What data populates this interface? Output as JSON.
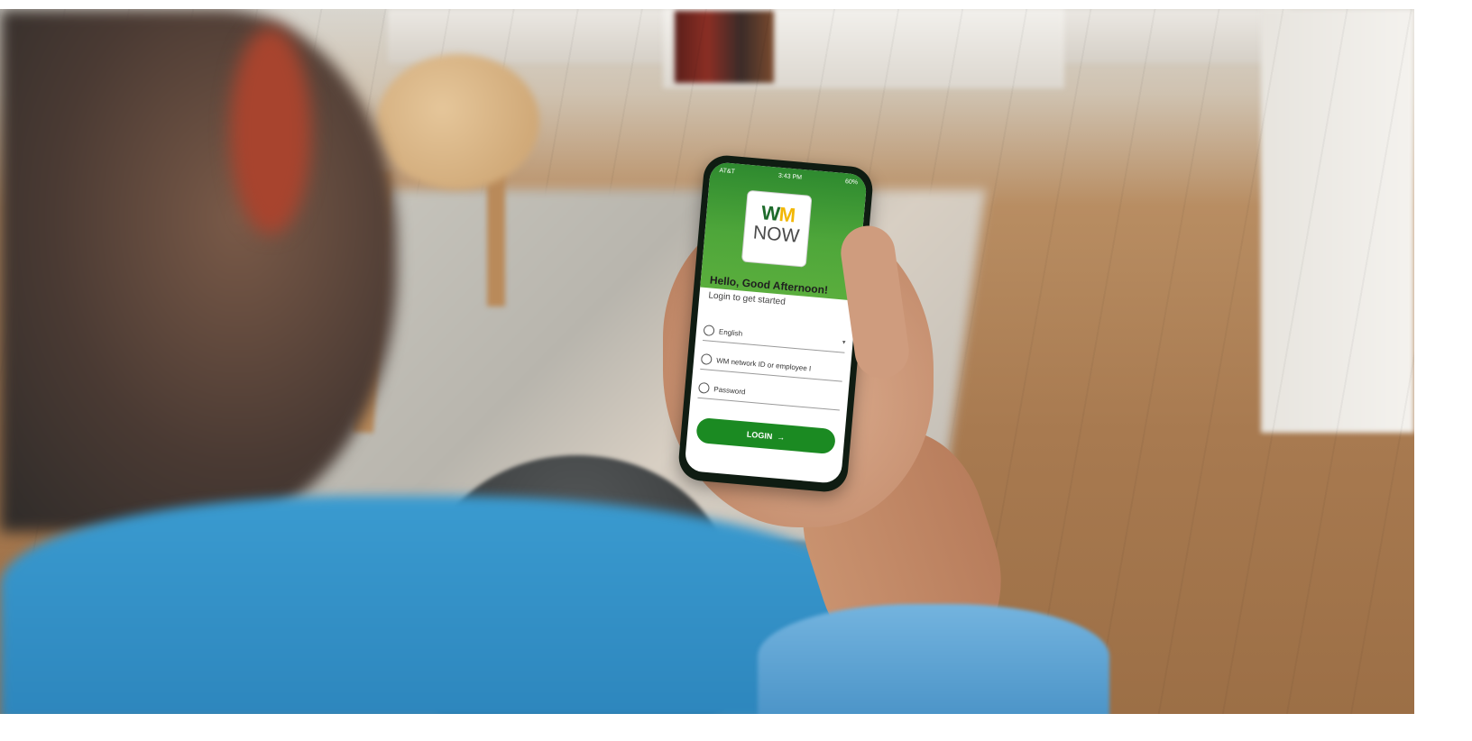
{
  "phone": {
    "status_bar": {
      "carrier": "AT&T",
      "time": "3:43 PM",
      "battery": "60%"
    },
    "logo": {
      "wm_w": "W",
      "wm_m": "M",
      "now": "NOW"
    },
    "greeting": "Hello, Good Afternoon!",
    "subtitle": "Login to get started",
    "language": {
      "value": "English",
      "icon": "globe-icon"
    },
    "username": {
      "placeholder": "WM network ID or employee I",
      "icon": "user-icon"
    },
    "password": {
      "placeholder": "Password",
      "icon": "lock-icon"
    },
    "login_button": {
      "label": "LOGIN",
      "arrow": "→"
    },
    "colors": {
      "brand_green": "#1b8a22",
      "header_green": "#4ea63a",
      "logo_yellow": "#f2b705"
    }
  }
}
